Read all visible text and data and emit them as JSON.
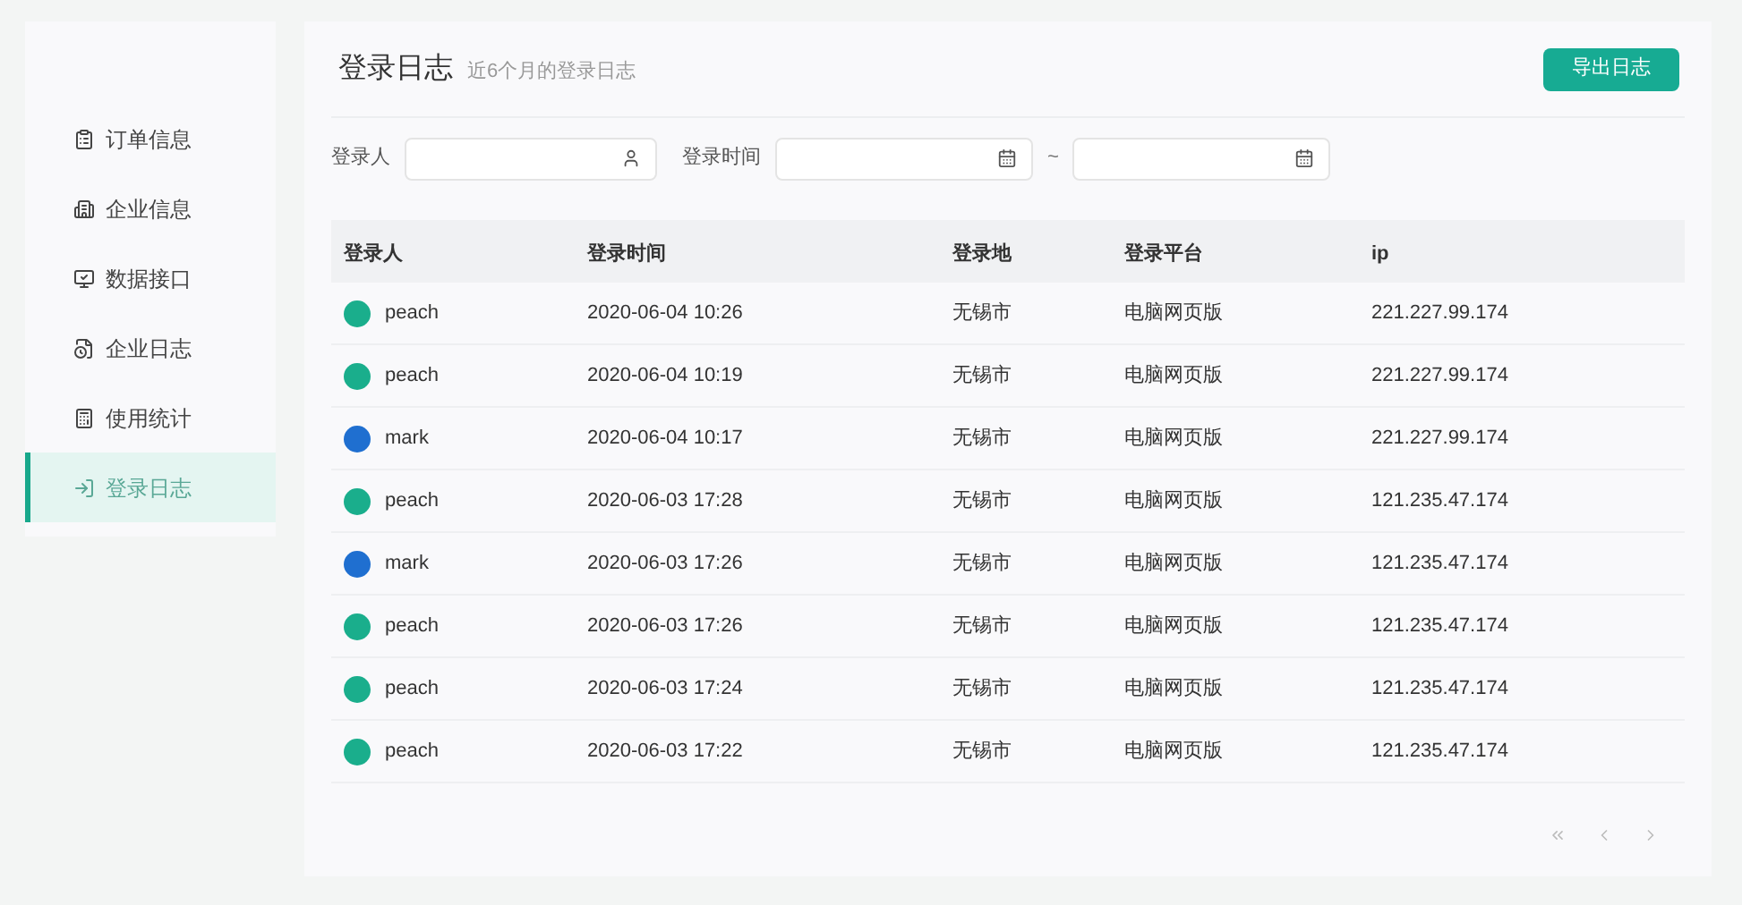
{
  "sidebar": {
    "items": [
      {
        "label": "订单信息",
        "selected": false
      },
      {
        "label": "企业信息",
        "selected": false
      },
      {
        "label": "数据接口",
        "selected": false
      },
      {
        "label": "企业日志",
        "selected": false
      },
      {
        "label": "使用统计",
        "selected": false
      },
      {
        "label": "登录日志",
        "selected": true
      }
    ]
  },
  "header": {
    "title": "登录日志",
    "subtitle": "近6个月的登录日志",
    "export_button": "导出日志"
  },
  "filters": {
    "user_label": "登录人",
    "time_label": "登录时间",
    "range_separator": "~"
  },
  "table": {
    "columns": [
      "登录人",
      "登录时间",
      "登录地",
      "登录平台",
      "ip"
    ],
    "rows": [
      {
        "user": "peach",
        "color": "#1aae8c",
        "time": "2020-06-04 10:26",
        "place": "无锡市",
        "platform": "电脑网页版",
        "ip": "221.227.99.174"
      },
      {
        "user": "peach",
        "color": "#1aae8c",
        "time": "2020-06-04 10:19",
        "place": "无锡市",
        "platform": "电脑网页版",
        "ip": "221.227.99.174"
      },
      {
        "user": "mark",
        "color": "#1f6fd0",
        "time": "2020-06-04 10:17",
        "place": "无锡市",
        "platform": "电脑网页版",
        "ip": "221.227.99.174"
      },
      {
        "user": "peach",
        "color": "#1aae8c",
        "time": "2020-06-03 17:28",
        "place": "无锡市",
        "platform": "电脑网页版",
        "ip": "121.235.47.174"
      },
      {
        "user": "mark",
        "color": "#1f6fd0",
        "time": "2020-06-03 17:26",
        "place": "无锡市",
        "platform": "电脑网页版",
        "ip": "121.235.47.174"
      },
      {
        "user": "peach",
        "color": "#1aae8c",
        "time": "2020-06-03 17:26",
        "place": "无锡市",
        "platform": "电脑网页版",
        "ip": "121.235.47.174"
      },
      {
        "user": "peach",
        "color": "#1aae8c",
        "time": "2020-06-03 17:24",
        "place": "无锡市",
        "platform": "电脑网页版",
        "ip": "121.235.47.174"
      },
      {
        "user": "peach",
        "color": "#1aae8c",
        "time": "2020-06-03 17:22",
        "place": "无锡市",
        "platform": "电脑网页版",
        "ip": "121.235.47.174"
      }
    ]
  }
}
